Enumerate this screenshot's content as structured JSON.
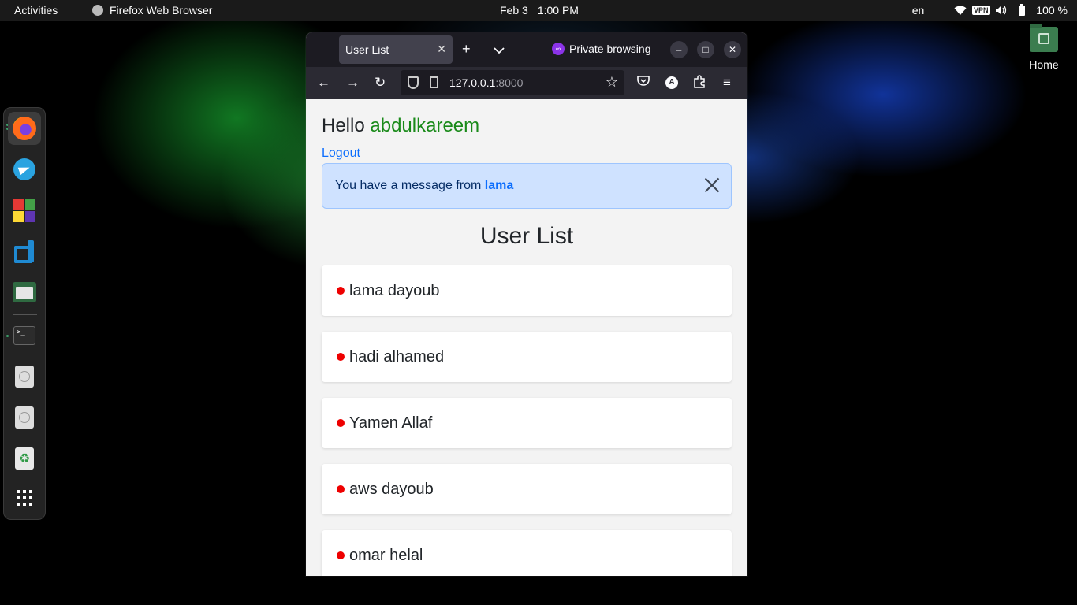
{
  "topbar": {
    "activities": "Activities",
    "app_name": "Firefox Web Browser",
    "date": "Feb 3",
    "time": "1:00 PM",
    "language": "en",
    "battery": "100 %"
  },
  "desktop": {
    "home_label": "Home"
  },
  "browser": {
    "tab_title": "User List",
    "private_label": "Private browsing",
    "url_host": "127.0.0.1",
    "url_port": ":8000"
  },
  "page": {
    "hello": "Hello",
    "username": "abdulkareem",
    "logout": "Logout",
    "alert_text": "You have a message from",
    "alert_sender": "lama",
    "list_title": "User List",
    "users": [
      {
        "name": "lama dayoub"
      },
      {
        "name": "hadi alhamed"
      },
      {
        "name": "Yamen Allaf"
      },
      {
        "name": "aws dayoub"
      },
      {
        "name": "omar helal"
      }
    ]
  },
  "colors": {
    "online_dot": "#ee0000",
    "username": "#198a19",
    "link": "#0d6efd",
    "alert_bg": "#cfe2ff"
  }
}
